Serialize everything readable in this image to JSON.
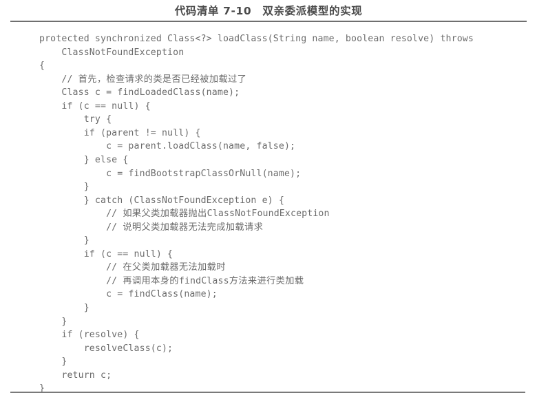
{
  "page": {
    "kind": "book-code-listing",
    "caption": "代码清单 7-10　双亲委派模型的实现",
    "rule_color": "#6f6f6f",
    "text_color": "#6b6b6b",
    "background_color": "#ffffff"
  },
  "code": {
    "language": "java",
    "lines": [
      "protected synchronized Class<?> loadClass(String name, boolean resolve) throws",
      "    ClassNotFoundException",
      "{",
      "    // 首先，检查请求的类是否已经被加载过了",
      "    Class c = findLoadedClass(name);",
      "    if (c == null) {",
      "        try {",
      "        if (parent != null) {",
      "            c = parent.loadClass(name, false);",
      "        } else {",
      "            c = findBootstrapClassOrNull(name);",
      "        }",
      "        } catch (ClassNotFoundException e) {",
      "            // 如果父类加载器抛出ClassNotFoundException",
      "            // 说明父类加载器无法完成加载请求",
      "        }",
      "        if (c == null) {",
      "            // 在父类加载器无法加载时",
      "            // 再调用本身的findClass方法来进行类加载",
      "            c = findClass(name);",
      "        }",
      "    }",
      "    if (resolve) {",
      "        resolveClass(c);",
      "    }",
      "    return c;",
      "}"
    ]
  }
}
